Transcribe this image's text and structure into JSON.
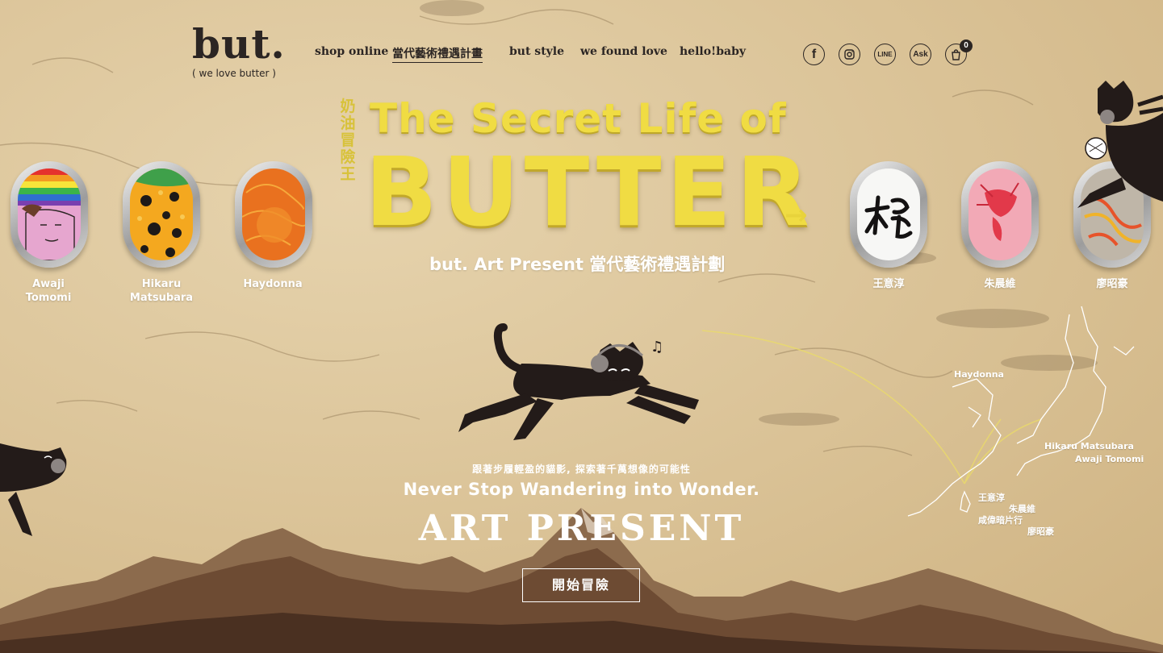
{
  "brand": {
    "name": "but.",
    "tagline": "( we love butter )"
  },
  "nav": [
    {
      "label": "shop online",
      "active": false
    },
    {
      "label": "當代藝術禮遇計畫",
      "active": true
    },
    {
      "label": "but style",
      "active": false
    },
    {
      "label": "we found love",
      "active": false
    },
    {
      "label": "hello!baby",
      "active": false
    }
  ],
  "social": [
    {
      "icon": "facebook-icon",
      "label": "f"
    },
    {
      "icon": "instagram-icon",
      "label": ""
    },
    {
      "icon": "line-icon",
      "label": "LINE"
    },
    {
      "icon": "ask-icon",
      "label": "Ask"
    },
    {
      "icon": "cart-icon",
      "label": ""
    }
  ],
  "cart": {
    "count": "0"
  },
  "hero": {
    "side_text": [
      "奶",
      "油",
      "冒",
      "險",
      "王"
    ],
    "title_top": "The Secret Life of",
    "title_main": "BUTTER",
    "subtitle": "but. Art Present 當代藝術禮遇計劃"
  },
  "artists_left": [
    {
      "line1": "Awaji",
      "line2": "Tomomi"
    },
    {
      "line1": "Hikaru",
      "line2": "Matsubara"
    },
    {
      "line1": "Haydonna",
      "line2": ""
    }
  ],
  "artists_right": [
    {
      "line1": "王意淳",
      "line2": ""
    },
    {
      "line1": "朱晨維",
      "line2": ""
    },
    {
      "line1": "廖昭豪",
      "line2": ""
    }
  ],
  "intro": {
    "tagline": "跟著步履輕盈的貓影, 探索著千萬想像的可能性",
    "headline": "Never Stop Wandering into Wonder.",
    "title": "ART PRESENT",
    "cta": "開始冒險"
  },
  "map_labels": {
    "haydonna": "Haydonna",
    "hikaru": "Hikaru Matsubara",
    "awaji": "Awaji Tomomi",
    "wang": "王意淳",
    "zhu": "朱晨維",
    "xian": "咸偉暗片行",
    "liao": "廖昭豪"
  },
  "colors": {
    "butter_yellow": "#f0dc43",
    "ink": "#2b2523",
    "stone": "#dcc59a",
    "white": "#ffffff"
  }
}
